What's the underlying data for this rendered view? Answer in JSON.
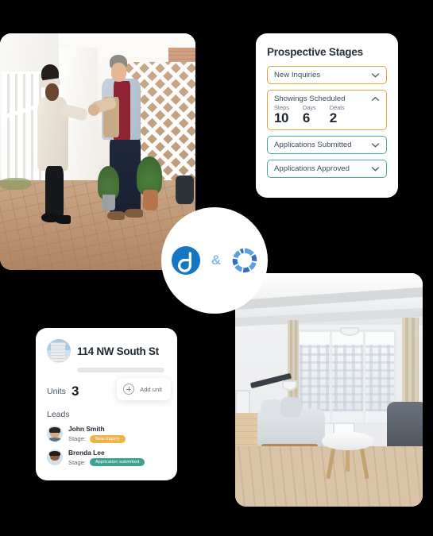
{
  "background_color": "#000000",
  "photos": [
    {
      "name": "handshake-photo",
      "alt": "Property manager and prospective renter shaking hands outside a white garden gate"
    },
    {
      "name": "living-room-photo",
      "alt": "Bright modern living room with grey sofa, round wood coffee table and large window"
    }
  ],
  "stages_card": {
    "title": "Prospective Stages",
    "accent_amber": "#e8a23c",
    "accent_teal": "#4aa89b",
    "rows": [
      {
        "label": "New Inquiries",
        "accent": "amber",
        "chevron": "chevron-down-icon",
        "expanded": false
      },
      {
        "label": "Showings Scheduled",
        "accent": "amber",
        "chevron": "chevron-up-icon",
        "expanded": true
      },
      {
        "label": "Applications Submitted",
        "accent": "teal",
        "chevron": "chevron-down-icon",
        "expanded": false
      },
      {
        "label": "Applications Approved",
        "accent": "teal",
        "chevron": "chevron-down-icon",
        "expanded": false
      }
    ],
    "metrics": [
      {
        "label": "Steps",
        "value": "10"
      },
      {
        "label": "Days",
        "value": "6"
      },
      {
        "label": "Deals",
        "value": "2"
      }
    ]
  },
  "property_card": {
    "thumbnail_icon": "building-thumbnail",
    "title": "114 NW South St",
    "units_label": "Units",
    "units_value": "3",
    "add_unit": {
      "icon": "plus-circle-icon",
      "label": "Add unit"
    },
    "leads_label": "Leads",
    "stage_key": "Stage:",
    "leads": [
      {
        "name": "John Smith",
        "stage": "New Inquiry",
        "badge_color": "amber",
        "badge_hex": "#f0b24a"
      },
      {
        "name": "Brenda Lee",
        "stage": "Application submitted",
        "badge_color": "teal",
        "badge_hex": "#3fa18f"
      }
    ]
  },
  "logo_badge": {
    "left_logo": "appfolio-a-logo-icon",
    "left_logo_color": "#1577c4",
    "ampersand": "&",
    "ampersand_color": "#8cbbe4",
    "right_logo": "segmented-ring-logo-icon",
    "right_logo_color": "#2f6fc4"
  }
}
